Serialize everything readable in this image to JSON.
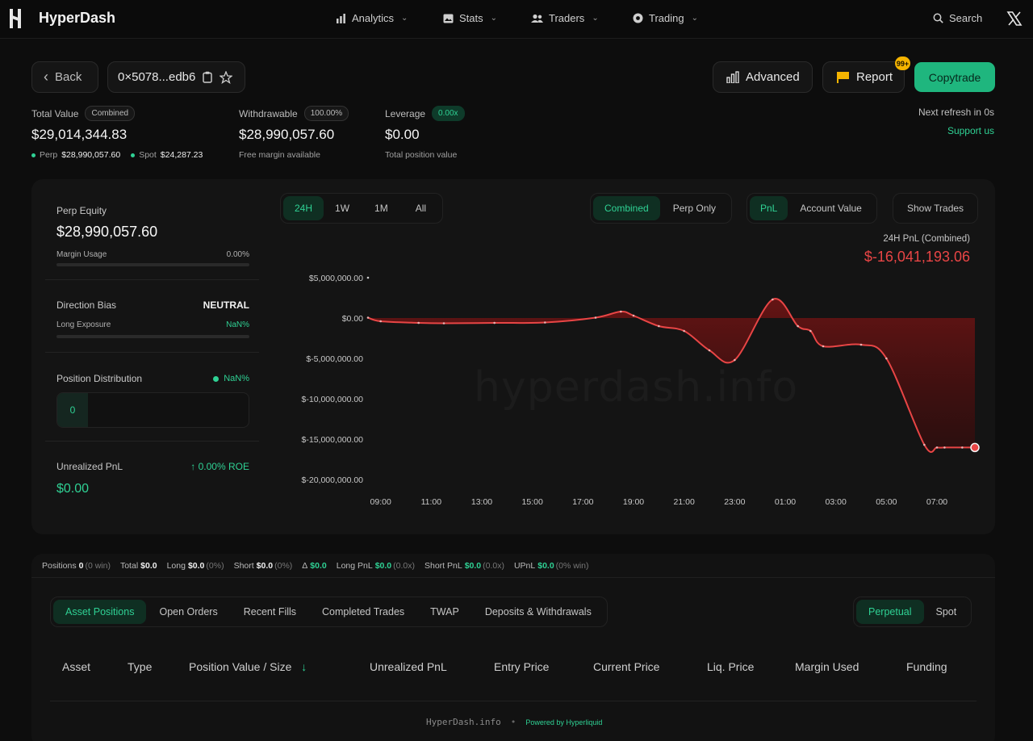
{
  "nav": {
    "brand": "HyperDash",
    "items": [
      "Analytics",
      "Stats",
      "Traders",
      "Trading"
    ],
    "search_label": "Search"
  },
  "header": {
    "back_label": "Back",
    "address": "0×5078...edb6",
    "advanced_label": "Advanced",
    "report_label": "Report",
    "report_badge": "99+",
    "copytrade_label": "Copytrade",
    "refresh_text": "Next refresh in 0s",
    "support_text": "Support us"
  },
  "stats": {
    "total_value_label": "Total Value",
    "total_value_tag": "Combined",
    "total_value": "$29,014,344.83",
    "perp_label": "Perp",
    "perp_value": "$28,990,057.60",
    "spot_label": "Spot",
    "spot_value": "$24,287.23",
    "withdrawable_label": "Withdrawable",
    "withdrawable_tag": "100.00%",
    "withdrawable_value": "$28,990,057.60",
    "withdrawable_sub": "Free margin available",
    "leverage_label": "Leverage",
    "leverage_tag": "0.00x",
    "leverage_value": "$0.00",
    "leverage_sub": "Total position value"
  },
  "left_panel": {
    "perp_equity_label": "Perp Equity",
    "perp_equity_value": "$28,990,057.60",
    "margin_usage_label": "Margin Usage",
    "margin_usage_value": "0.00%",
    "margin_usage_fraction": 0,
    "direction_bias_label": "Direction Bias",
    "direction_bias_value": "NEUTRAL",
    "long_exposure_label": "Long Exposure",
    "long_exposure_value": "NaN%",
    "position_dist_label": "Position Distribution",
    "position_dist_value": "NaN%",
    "position_dist_count": "0",
    "unrealized_label": "Unrealized PnL",
    "unrealized_roe": "0.00% ROE",
    "unrealized_value": "$0.00"
  },
  "chart_controls": {
    "ranges": [
      "24H",
      "1W",
      "1M",
      "All"
    ],
    "active_range": "24H",
    "modes": [
      "Combined",
      "Perp Only"
    ],
    "active_mode": "Combined",
    "metrics": [
      "PnL",
      "Account Value"
    ],
    "active_metric": "PnL",
    "show_trades_label": "Show Trades"
  },
  "chart_header": {
    "label": "24H PnL (Combined)",
    "value": "$-16,041,193.06"
  },
  "watermark": "hyperdash.info",
  "chart_data": {
    "type": "area",
    "xlabel": "",
    "ylabel": "",
    "x_ticks": [
      "09:00",
      "11:00",
      "13:00",
      "15:00",
      "17:00",
      "19:00",
      "21:00",
      "23:00",
      "01:00",
      "03:00",
      "05:00",
      "07:00"
    ],
    "y_ticks": [
      "$5,000,000.00",
      "$0.00",
      "$-5,000,000.00",
      "$-10,000,000.00",
      "$-15,000,000.00",
      "$-20,000,000.00"
    ],
    "ylim": [
      -20000000,
      5000000
    ],
    "x_hours": [
      8.5,
      9.0,
      10.5,
      11.5,
      13.5,
      15.5,
      17.5,
      18.5,
      19.0,
      20.0,
      21.0,
      22.0,
      23.0,
      24.5,
      25.5,
      26.0,
      26.5,
      28.0,
      29.0,
      30.5,
      31.0,
      31.3,
      32.0,
      32.5
    ],
    "values": [
      50000,
      -400000,
      -600000,
      -650000,
      -600000,
      -550000,
      50000,
      800000,
      300000,
      -1000000,
      -1600000,
      -4000000,
      -5200000,
      2300000,
      -1000000,
      -1600000,
      -3500000,
      -3300000,
      -5000000,
      -15700000,
      -16041193,
      -16041193,
      -16041193,
      -16041193
    ],
    "color": "#e84545",
    "fill_color": "#6e1414"
  },
  "summary": {
    "positions_label": "Positions",
    "positions_value": "0",
    "positions_note": "(0 win)",
    "total_label": "Total",
    "total_value": "$0.0",
    "long_label": "Long",
    "long_value": "$0.0",
    "long_note": "(0%)",
    "short_label": "Short",
    "short_value": "$0.0",
    "short_note": "(0%)",
    "delta_label": "Δ",
    "delta_value": "$0.0",
    "longpnl_label": "Long PnL",
    "longpnl_value": "$0.0",
    "longpnl_note": "(0.0x)",
    "shortpnl_label": "Short PnL",
    "shortpnl_value": "$0.0",
    "shortpnl_note": "(0.0x)",
    "upnl_label": "UPnL",
    "upnl_value": "$0.0",
    "upnl_note": "(0% win)"
  },
  "tabs": [
    "Asset Positions",
    "Open Orders",
    "Recent Fills",
    "Completed Trades",
    "TWAP",
    "Deposits & Withdrawals"
  ],
  "active_tab": "Asset Positions",
  "market_tabs": [
    "Perpetual",
    "Spot"
  ],
  "active_market_tab": "Perpetual",
  "table_headers": [
    "Asset",
    "Type",
    "Position Value / Size",
    "Unrealized PnL",
    "Entry Price",
    "Current Price",
    "Liq. Price",
    "Margin Used",
    "Funding"
  ],
  "footer": {
    "site": "HyperDash.info",
    "powered": "Powered by Hyperliquid"
  },
  "colors": {
    "accent": "#1fb67e",
    "accent_text": "#2fd194",
    "negative": "#e84545",
    "badge": "#f5b400"
  }
}
